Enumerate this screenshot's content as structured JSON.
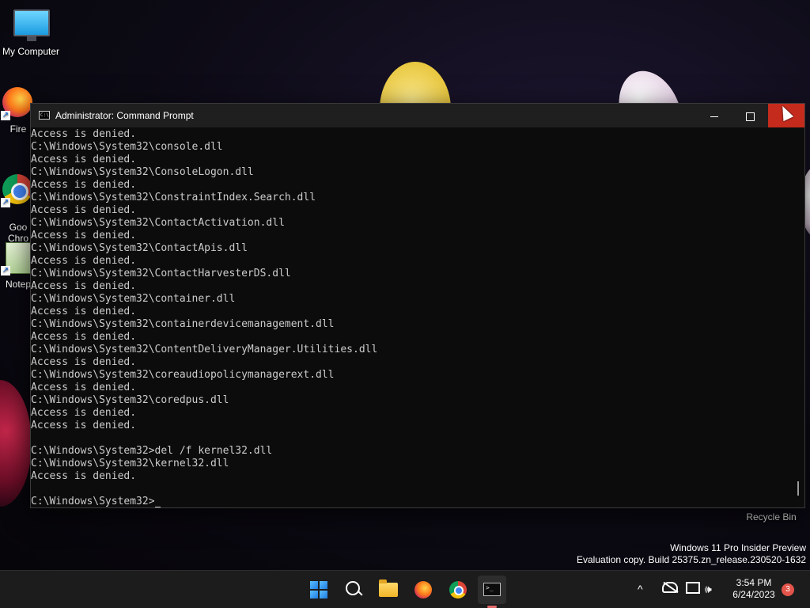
{
  "desktop": {
    "icons": [
      {
        "label": "My Computer",
        "icon": "monitor-icon"
      },
      {
        "label": "Fire",
        "icon": "firefox-icon"
      },
      {
        "label": "Goo\nChro",
        "icon": "chrome-icon"
      },
      {
        "label": "Notep",
        "icon": "notepad-icon"
      }
    ],
    "recycle_bin_label": "Recycle Bin",
    "watermark": {
      "line1": "Windows 11 Pro Insider Preview",
      "line2": "Evaluation copy. Build 25375.zn_release.230520-1632"
    }
  },
  "cmd_window": {
    "title": "Administrator: Command Prompt",
    "icon_text": "C:\\",
    "lines": [
      "Access is denied.",
      "C:\\Windows\\System32\\console.dll",
      "Access is denied.",
      "C:\\Windows\\System32\\ConsoleLogon.dll",
      "Access is denied.",
      "C:\\Windows\\System32\\ConstraintIndex.Search.dll",
      "Access is denied.",
      "C:\\Windows\\System32\\ContactActivation.dll",
      "Access is denied.",
      "C:\\Windows\\System32\\ContactApis.dll",
      "Access is denied.",
      "C:\\Windows\\System32\\ContactHarvesterDS.dll",
      "Access is denied.",
      "C:\\Windows\\System32\\container.dll",
      "Access is denied.",
      "C:\\Windows\\System32\\containerdevicemanagement.dll",
      "Access is denied.",
      "C:\\Windows\\System32\\ContentDeliveryManager.Utilities.dll",
      "Access is denied.",
      "C:\\Windows\\System32\\coreaudiopolicymanagerext.dll",
      "Access is denied.",
      "C:\\Windows\\System32\\coredpus.dll",
      "Access is denied.",
      "Access is denied.",
      "",
      "C:\\Windows\\System32>del /f kernel32.dll",
      "C:\\Windows\\System32\\kernel32.dll",
      "Access is denied.",
      ""
    ],
    "prompt": "C:\\Windows\\System32>"
  },
  "taskbar": {
    "apps": [
      {
        "name": "Start",
        "icon": "windows-logo-icon"
      },
      {
        "name": "Search",
        "icon": "search-icon"
      },
      {
        "name": "File Explorer",
        "icon": "folder-icon"
      },
      {
        "name": "Firefox",
        "icon": "firefox-icon"
      },
      {
        "name": "Google Chrome",
        "icon": "chrome-icon"
      },
      {
        "name": "Command Prompt",
        "icon": "terminal-icon",
        "active": true
      }
    ],
    "cmd_icon_text": ">_",
    "tray_chevron": "^",
    "volume_glyph": "🕪",
    "clock": {
      "time": "3:54 PM",
      "date": "6/24/2023"
    },
    "notification_count": "3"
  },
  "colors": {
    "close_button": "#c42b1c",
    "console_text": "#cccccc",
    "console_bg": "#0c0c0c",
    "notification_badge": "#e3544a"
  }
}
